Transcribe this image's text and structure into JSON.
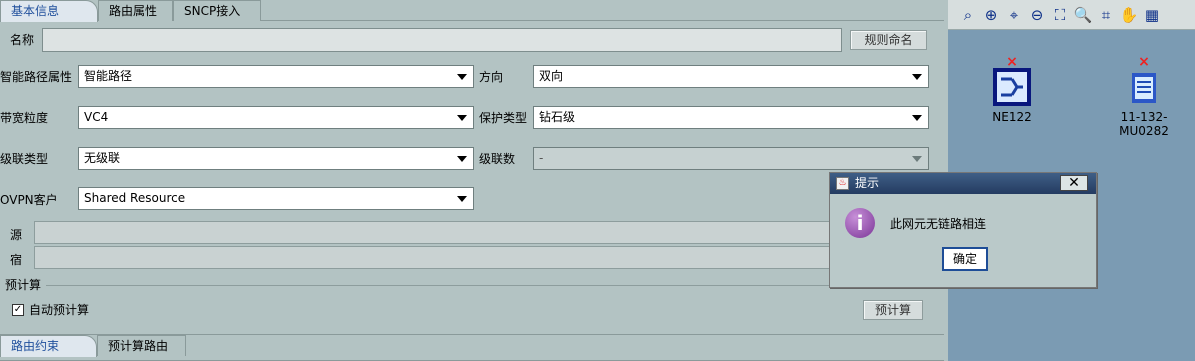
{
  "top_tabs": [
    "基本信息",
    "路由属性",
    "SNCP接入"
  ],
  "form": {
    "name_label": "名称",
    "name_value": "",
    "rule_name_button": "规则命名",
    "smart_path_label": "智能路径属性",
    "smart_path_value": "智能路径",
    "direction_label": "方向",
    "direction_value": "双向",
    "bandwidth_label": "带宽粒度",
    "bandwidth_value": "VC4",
    "protection_label": "保护类型",
    "protection_value": "钻石级",
    "cascade_type_label": "级联类型",
    "cascade_type_value": "无级联",
    "cascade_count_label": "级联数",
    "cascade_count_value": "-",
    "ovpn_label": "OVPN客户",
    "ovpn_value": "Shared Resource",
    "source_label": "源",
    "sink_label": "宿"
  },
  "precalc": {
    "group_label": "预计算",
    "auto_label": "自动预计算",
    "auto_checked": true,
    "button": "预计算"
  },
  "bottom_tabs": [
    "路由约束",
    "预计算路由"
  ],
  "toolbar_icons": [
    "select-icon",
    "zoom-in-icon",
    "zoom-region-icon",
    "zoom-out-icon",
    "fit-icon",
    "magnifier-icon",
    "zoom-box-icon",
    "hand-icon",
    "table-icon"
  ],
  "topology": {
    "nodes": [
      {
        "label": "NE122"
      },
      {
        "label": "11-132-MU0282"
      }
    ]
  },
  "dialog": {
    "title": "提示",
    "close": "✕",
    "message": "此网元无链路相连",
    "ok": "确定"
  }
}
